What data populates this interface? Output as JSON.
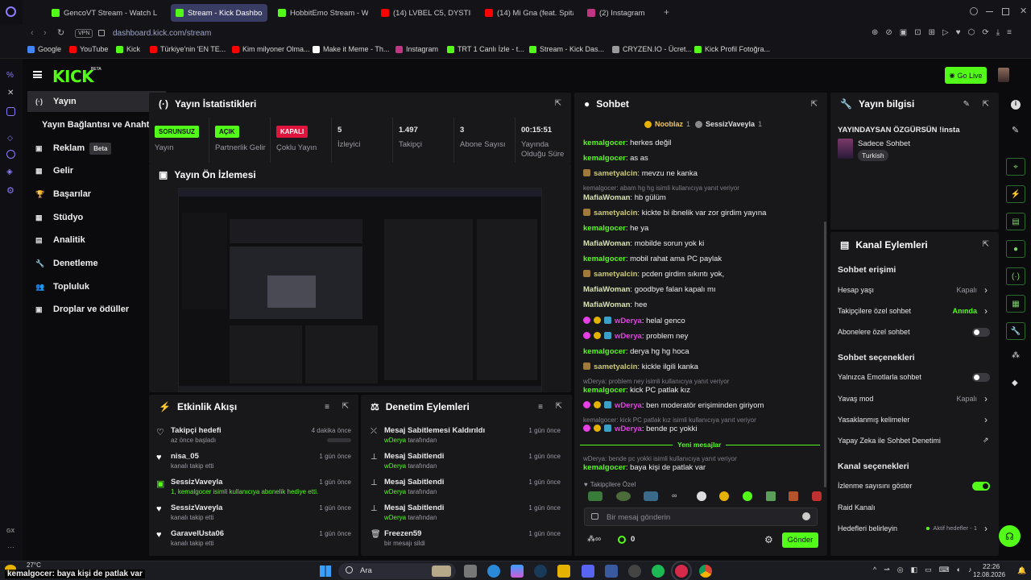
{
  "browser": {
    "tabs": [
      {
        "label": "GencoVT Stream - Watch L",
        "color": "#53fc18"
      },
      {
        "label": "Stream - Kick Dashboard",
        "color": "#53fc18",
        "active": true
      },
      {
        "label": "HobbitEmo Stream - Watc",
        "color": "#53fc18"
      },
      {
        "label": "(14) LVBEL C5, DYSTINCT",
        "color": "#ff0000"
      },
      {
        "label": "(14) Mi Gna (feat. Spitakci",
        "color": "#ff0000"
      },
      {
        "label": "(2) Instagram",
        "color": "#c13584"
      }
    ],
    "vpn": "VPN",
    "url": "dashboard.kick.com/stream",
    "bookmarks": [
      "Google",
      "YouTube",
      "Kick",
      "Türkiye'nin 'EN TE...",
      "Kim milyoner Olma...",
      "Make it Meme - Th...",
      "Instagram",
      "TRT 1 Canlı İzle - t...",
      "Stream - Kick Das...",
      "CRYZEN.IO - Ücret...",
      "Kick Profil Fotoğra..."
    ],
    "gx": "GX"
  },
  "header": {
    "logo": "KICK",
    "beta": "BETA",
    "go_live": "Go Live"
  },
  "sidebar": {
    "items": [
      {
        "label": "Yayın",
        "active": true
      },
      {
        "label": "Yayın Bağlantısı ve Anahtarı"
      },
      {
        "label": "Reklam",
        "badge": "Beta"
      },
      {
        "label": "Gelir"
      },
      {
        "label": "Başarılar"
      },
      {
        "label": "Stüdyo",
        "chev": true
      },
      {
        "label": "Analitik",
        "chev": true
      },
      {
        "label": "Denetleme"
      },
      {
        "label": "Topluluk",
        "chev": true
      },
      {
        "label": "Droplar ve ödüller"
      }
    ]
  },
  "stats": {
    "title": "Yayın İstatistikleri",
    "cells": [
      {
        "badge": "SORUNSUZ",
        "label": "Yayın"
      },
      {
        "badge": "AÇIK",
        "label": "Partnerlik Gelir"
      },
      {
        "badge": "KAPALI",
        "label": "Çoklu Yayın"
      },
      {
        "value": "5",
        "label": "İzleyici"
      },
      {
        "value": "1.497",
        "label": "Takipçi"
      },
      {
        "value": "3",
        "label": "Abone Sayısı"
      },
      {
        "value": "00:15:51",
        "label": "Yayında Olduğu Süre"
      }
    ]
  },
  "preview": {
    "title": "Yayın Ön İzlemesi"
  },
  "activity": {
    "title": "Etkinlik Akışı",
    "items": [
      {
        "name": "Takipçi hedefi",
        "sub": "az önce başladı",
        "time": "4 dakika önce"
      },
      {
        "name": "nisa_05",
        "sub": "kanalı takip etti",
        "time": "1 gün önce"
      },
      {
        "name": "SessizVaveyla",
        "sub": "1, kemalgocer isimli kullanıcıya abonelik hediye etti.",
        "time": "1 gün önce"
      },
      {
        "name": "SessizVaveyla",
        "sub": "kanalı takip etti",
        "time": "1 gün önce"
      },
      {
        "name": "GaravelUsta06",
        "sub": "kanalı takip etti",
        "time": "1 gün önce"
      }
    ]
  },
  "moderation": {
    "title": "Denetim Eylemleri",
    "items": [
      {
        "name": "Mesaj Sabitlemesi Kaldırıldı",
        "user": "wDerya",
        "sub": "tarafından",
        "time": "1 gün önce"
      },
      {
        "name": "Mesaj Sabitlendi",
        "user": "wDerya",
        "sub": "tarafından",
        "time": "1 gün önce"
      },
      {
        "name": "Mesaj Sabitlendi",
        "user": "wDerya",
        "sub": "tarafından",
        "time": "1 gün önce"
      },
      {
        "name": "Mesaj Sabitlendi",
        "user": "wDerya",
        "sub": "tarafından",
        "time": "1 gün önce"
      },
      {
        "name": "Freezen59",
        "user": "",
        "sub": "bir mesajı sildi",
        "time": "1 gün önce"
      }
    ]
  },
  "chat": {
    "title": "Sohbet",
    "top1": "Nooblaz",
    "top1n": "1",
    "top2": "SessizVaveyla",
    "top2n": "1",
    "new_messages": "Yeni mesajlar",
    "followers_only": "Takipçilere Özel",
    "placeholder": "Bir mesaj gönderin",
    "count": "0",
    "send": "Gönder",
    "lines": [
      {
        "u": "kemalgocer",
        "t": "herkes değil",
        "c": "k"
      },
      {
        "u": "kemalgocer",
        "t": "as as",
        "c": "k"
      },
      {
        "u": "sametyalcin",
        "t": "mevzu ne kanka",
        "c": "s",
        "icon": true
      },
      {
        "reply": "kemalgocer: abam hg hg isimli kullanıcıya yanıt veriyor"
      },
      {
        "u": "MafiaWoman",
        "t": "hb gülüm",
        "c": "m"
      },
      {
        "u": "sametyalcin",
        "t": "kickte bi ibnelik var zor girdim yayına",
        "c": "s",
        "icon": true
      },
      {
        "u": "kemalgocer",
        "t": "he ya",
        "c": "k"
      },
      {
        "u": "MafiaWoman",
        "t": "mobilde sorun yok ki",
        "c": "m"
      },
      {
        "u": "kemalgocer",
        "t": "mobil rahat ama PC paylak",
        "c": "k"
      },
      {
        "u": "sametyalcin",
        "t": "pcden girdim sıkıntı yok,",
        "c": "s",
        "icon": true
      },
      {
        "u": "MafiaWoman",
        "t": "goodbye falan kapalı mı",
        "c": "m"
      },
      {
        "u": "MafiaWoman",
        "t": "hee",
        "c": "m"
      },
      {
        "u": "wDerya",
        "t": "helal genco",
        "c": "w",
        "badges": true
      },
      {
        "u": "wDerya",
        "t": "problem ney",
        "c": "w",
        "badges": true
      },
      {
        "u": "kemalgocer",
        "t": "derya hg hg hoca",
        "c": "k"
      },
      {
        "u": "sametyalcin",
        "t": "kickle ilgili kanka",
        "c": "s",
        "icon": true
      },
      {
        "reply": "wDerya: problem ney isimli kullanıcıya yanıt veriyor"
      },
      {
        "u": "kemalgocer",
        "t": "kick PC patlak kız",
        "c": "k"
      },
      {
        "u": "wDerya",
        "t": "ben moderatör erişiminden giriyom",
        "c": "w",
        "badges": true
      },
      {
        "reply": "kemalgocer: kick PC patlak kız isimli kullanıcıya yanıt veriyor"
      },
      {
        "u": "wDerya",
        "t": "bende pc yokki",
        "c": "w",
        "badges": true
      },
      {
        "sep": true
      },
      {
        "reply": "wDerya: bende pc yokki isimli kullanıcıya yanıt veriyor"
      },
      {
        "u": "kemalgocer",
        "t": "baya kişi de patlak var",
        "c": "k"
      }
    ]
  },
  "info": {
    "title": "Yayın bilgisi",
    "stream_title": "YAYINDAYSAN ÖZGÜRSÜN !insta",
    "category": "Sadece Sohbet",
    "tag": "Turkish"
  },
  "actions": {
    "title": "Kanal Eylemleri",
    "sec1": "Sohbet erişimi",
    "rows1": [
      {
        "label": "Hesap yaşı",
        "value": "Kapalı",
        "chev": true
      },
      {
        "label": "Takipçilere özel sohbet",
        "value": "Anında",
        "green": true,
        "chev": true
      },
      {
        "label": "Abonelere özel sohbet",
        "toggle": false
      }
    ],
    "sec2": "Sohbet seçenekleri",
    "rows2": [
      {
        "label": "Yalnızca Emotlarla sohbet",
        "toggle": false
      },
      {
        "label": "Yavaş mod",
        "value": "Kapalı",
        "chev": true
      },
      {
        "label": "Yasaklanmış kelimeler",
        "chev": true
      },
      {
        "label": "Yapay Zeka ile Sohbet Denetimi",
        "ext": true
      }
    ],
    "sec3": "Kanal seçenekleri",
    "rows3": [
      {
        "label": "İzlenme sayısını göster",
        "toggle": true
      },
      {
        "label": "Raid Kanalı"
      },
      {
        "label": "Hedefleri belirleyin",
        "value": "Aktif hedefler - 1",
        "chev": true
      }
    ]
  },
  "taskbar": {
    "temp": "27°C",
    "overlay": "kemalgocer: baya kişi de patlak var",
    "search": "Ara",
    "time": "22:26",
    "date": "12.08.2026"
  }
}
